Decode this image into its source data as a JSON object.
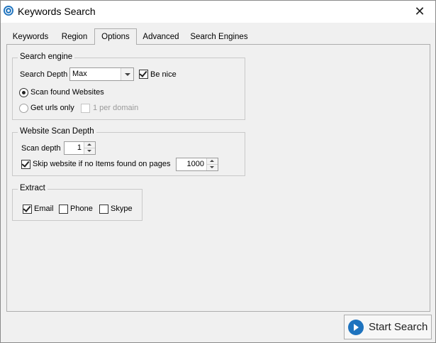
{
  "window": {
    "title": "Keywords Search",
    "icon": "target-icon",
    "close_glyph": "✕"
  },
  "tabs": [
    {
      "label": "Keywords",
      "active": false
    },
    {
      "label": "Region",
      "active": false
    },
    {
      "label": "Options",
      "active": true
    },
    {
      "label": "Advanced",
      "active": false
    },
    {
      "label": "Search Engines",
      "active": false
    }
  ],
  "search_engine": {
    "legend": "Search engine",
    "depth_label": "Search Depth",
    "depth_value": "Max",
    "be_nice_label": "Be nice",
    "be_nice_checked": true,
    "scan_found_label": "Scan found Websites",
    "scan_found_selected": true,
    "get_urls_label": "Get urls only",
    "get_urls_selected": false,
    "one_per_domain_label": "1 per domain",
    "one_per_domain_checked": false,
    "one_per_domain_enabled": false
  },
  "website_scan": {
    "legend": "Website Scan Depth",
    "scan_depth_label": "Scan depth",
    "scan_depth_value": "1",
    "skip_label": "Skip website if no Items found on pages",
    "skip_checked": true,
    "skip_pages_value": "1000"
  },
  "extract": {
    "legend": "Extract",
    "email_label": "Email",
    "email_checked": true,
    "phone_label": "Phone",
    "phone_checked": false,
    "skype_label": "Skype",
    "skype_checked": false
  },
  "start_button": {
    "label": "Start Search",
    "icon": "play-circle-icon"
  },
  "colors": {
    "accent": "#1e73be",
    "background": "#f0f0f0"
  }
}
